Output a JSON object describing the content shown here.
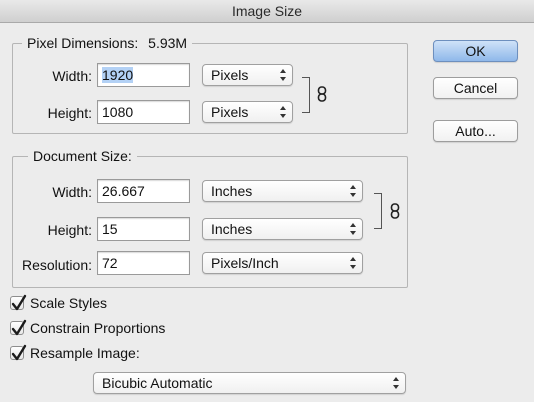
{
  "window": {
    "title": "Image Size"
  },
  "pixel_dimensions": {
    "label": "Pixel Dimensions:",
    "size": "5.93M",
    "width_label": "Width:",
    "width_value": "1920",
    "width_unit": "Pixels",
    "height_label": "Height:",
    "height_value": "1080",
    "height_unit": "Pixels",
    "link_icon": "chain-link-icon"
  },
  "document_size": {
    "label": "Document Size:",
    "width_label": "Width:",
    "width_value": "26.667",
    "width_unit": "Inches",
    "height_label": "Height:",
    "height_value": "15",
    "height_unit": "Inches",
    "resolution_label": "Resolution:",
    "resolution_value": "72",
    "resolution_unit": "Pixels/Inch",
    "link_icon": "chain-link-icon"
  },
  "options": {
    "scale_styles": {
      "label": "Scale Styles",
      "checked": true
    },
    "constrain_proportions": {
      "label": "Constrain Proportions",
      "checked": true
    },
    "resample_image": {
      "label": "Resample Image:",
      "checked": true
    },
    "resample_method": "Bicubic Automatic"
  },
  "buttons": {
    "ok": "OK",
    "cancel": "Cancel",
    "auto": "Auto..."
  },
  "colors": {
    "background": "#ececec",
    "default_button": "#8fb8ea",
    "selection": "#b3d1f5"
  }
}
